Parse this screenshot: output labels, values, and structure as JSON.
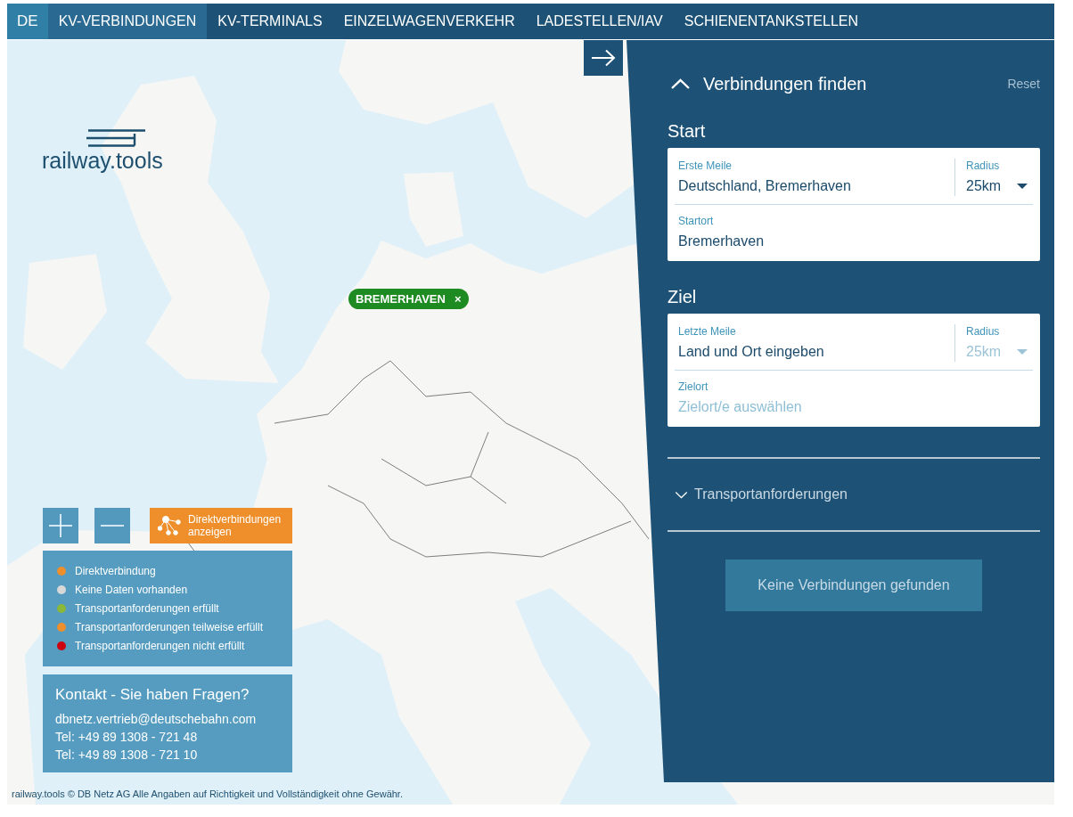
{
  "nav": {
    "language": "DE",
    "tabs": [
      {
        "label": "KV-VERBINDUNGEN",
        "selected": true
      },
      {
        "label": "KV-TERMINALS",
        "selected": false
      },
      {
        "label": "EINZELWAGENVERKEHR",
        "selected": false
      },
      {
        "label": "LADESTELLEN/IAV",
        "selected": false
      },
      {
        "label": "SCHIENENTANKSTELLEN",
        "selected": false
      }
    ]
  },
  "logo": {
    "text": "railway.tools"
  },
  "marker": {
    "label": "BREMERHAVEN",
    "close": "×"
  },
  "direct_button": {
    "label": "Direktverbindungen anzeigen"
  },
  "legend": {
    "items": [
      {
        "label": "Direktverbindung",
        "color": "#ee8f2c"
      },
      {
        "label": "Keine Daten vorhanden",
        "color": "#d8d8d8"
      },
      {
        "label": "Transportanforderungen erfüllt",
        "color": "#8bb83a"
      },
      {
        "label": "Transportanforderungen teilweise erfüllt",
        "color": "#ee8f2c"
      },
      {
        "label": "Transportanforderungen nicht erfüllt",
        "color": "#cc0011"
      }
    ]
  },
  "contact": {
    "title": "Kontakt - Sie haben Fragen?",
    "lines": [
      "dbnetz.vertrieb@deutschebahn.com",
      "Tel: +49 89 1308 - 721 48",
      "Tel: +49 89 1308 - 721 10"
    ]
  },
  "attribution": "railway.tools © DB Netz AG Alle Angaben auf Richtigkeit und Vollständigkeit ohne Gewähr.",
  "panel": {
    "title": "Verbindungen finden",
    "expanded": true,
    "reset": "Reset",
    "sections": [
      {
        "heading": "Start",
        "location": {
          "label": "Erste Meile",
          "value": "Deutschland, Bremerhaven"
        },
        "radius": {
          "label": "Radius",
          "value": "25km",
          "disabled": false
        },
        "place": {
          "label": "Startort",
          "value": "Bremerhaven"
        }
      },
      {
        "heading": "Ziel",
        "location": {
          "label": "Letzte Meile",
          "value": "Land und Ort eingeben"
        },
        "radius": {
          "label": "Radius",
          "value": "25km",
          "disabled": true
        },
        "place": {
          "label": "Zielort",
          "placeholder": "Zielort/e auswählen"
        }
      }
    ],
    "requirements": {
      "label": "Transportanforderungen",
      "expanded": false
    },
    "submit": {
      "label": "Keine Verbindungen gefunden",
      "disabled": true
    }
  }
}
